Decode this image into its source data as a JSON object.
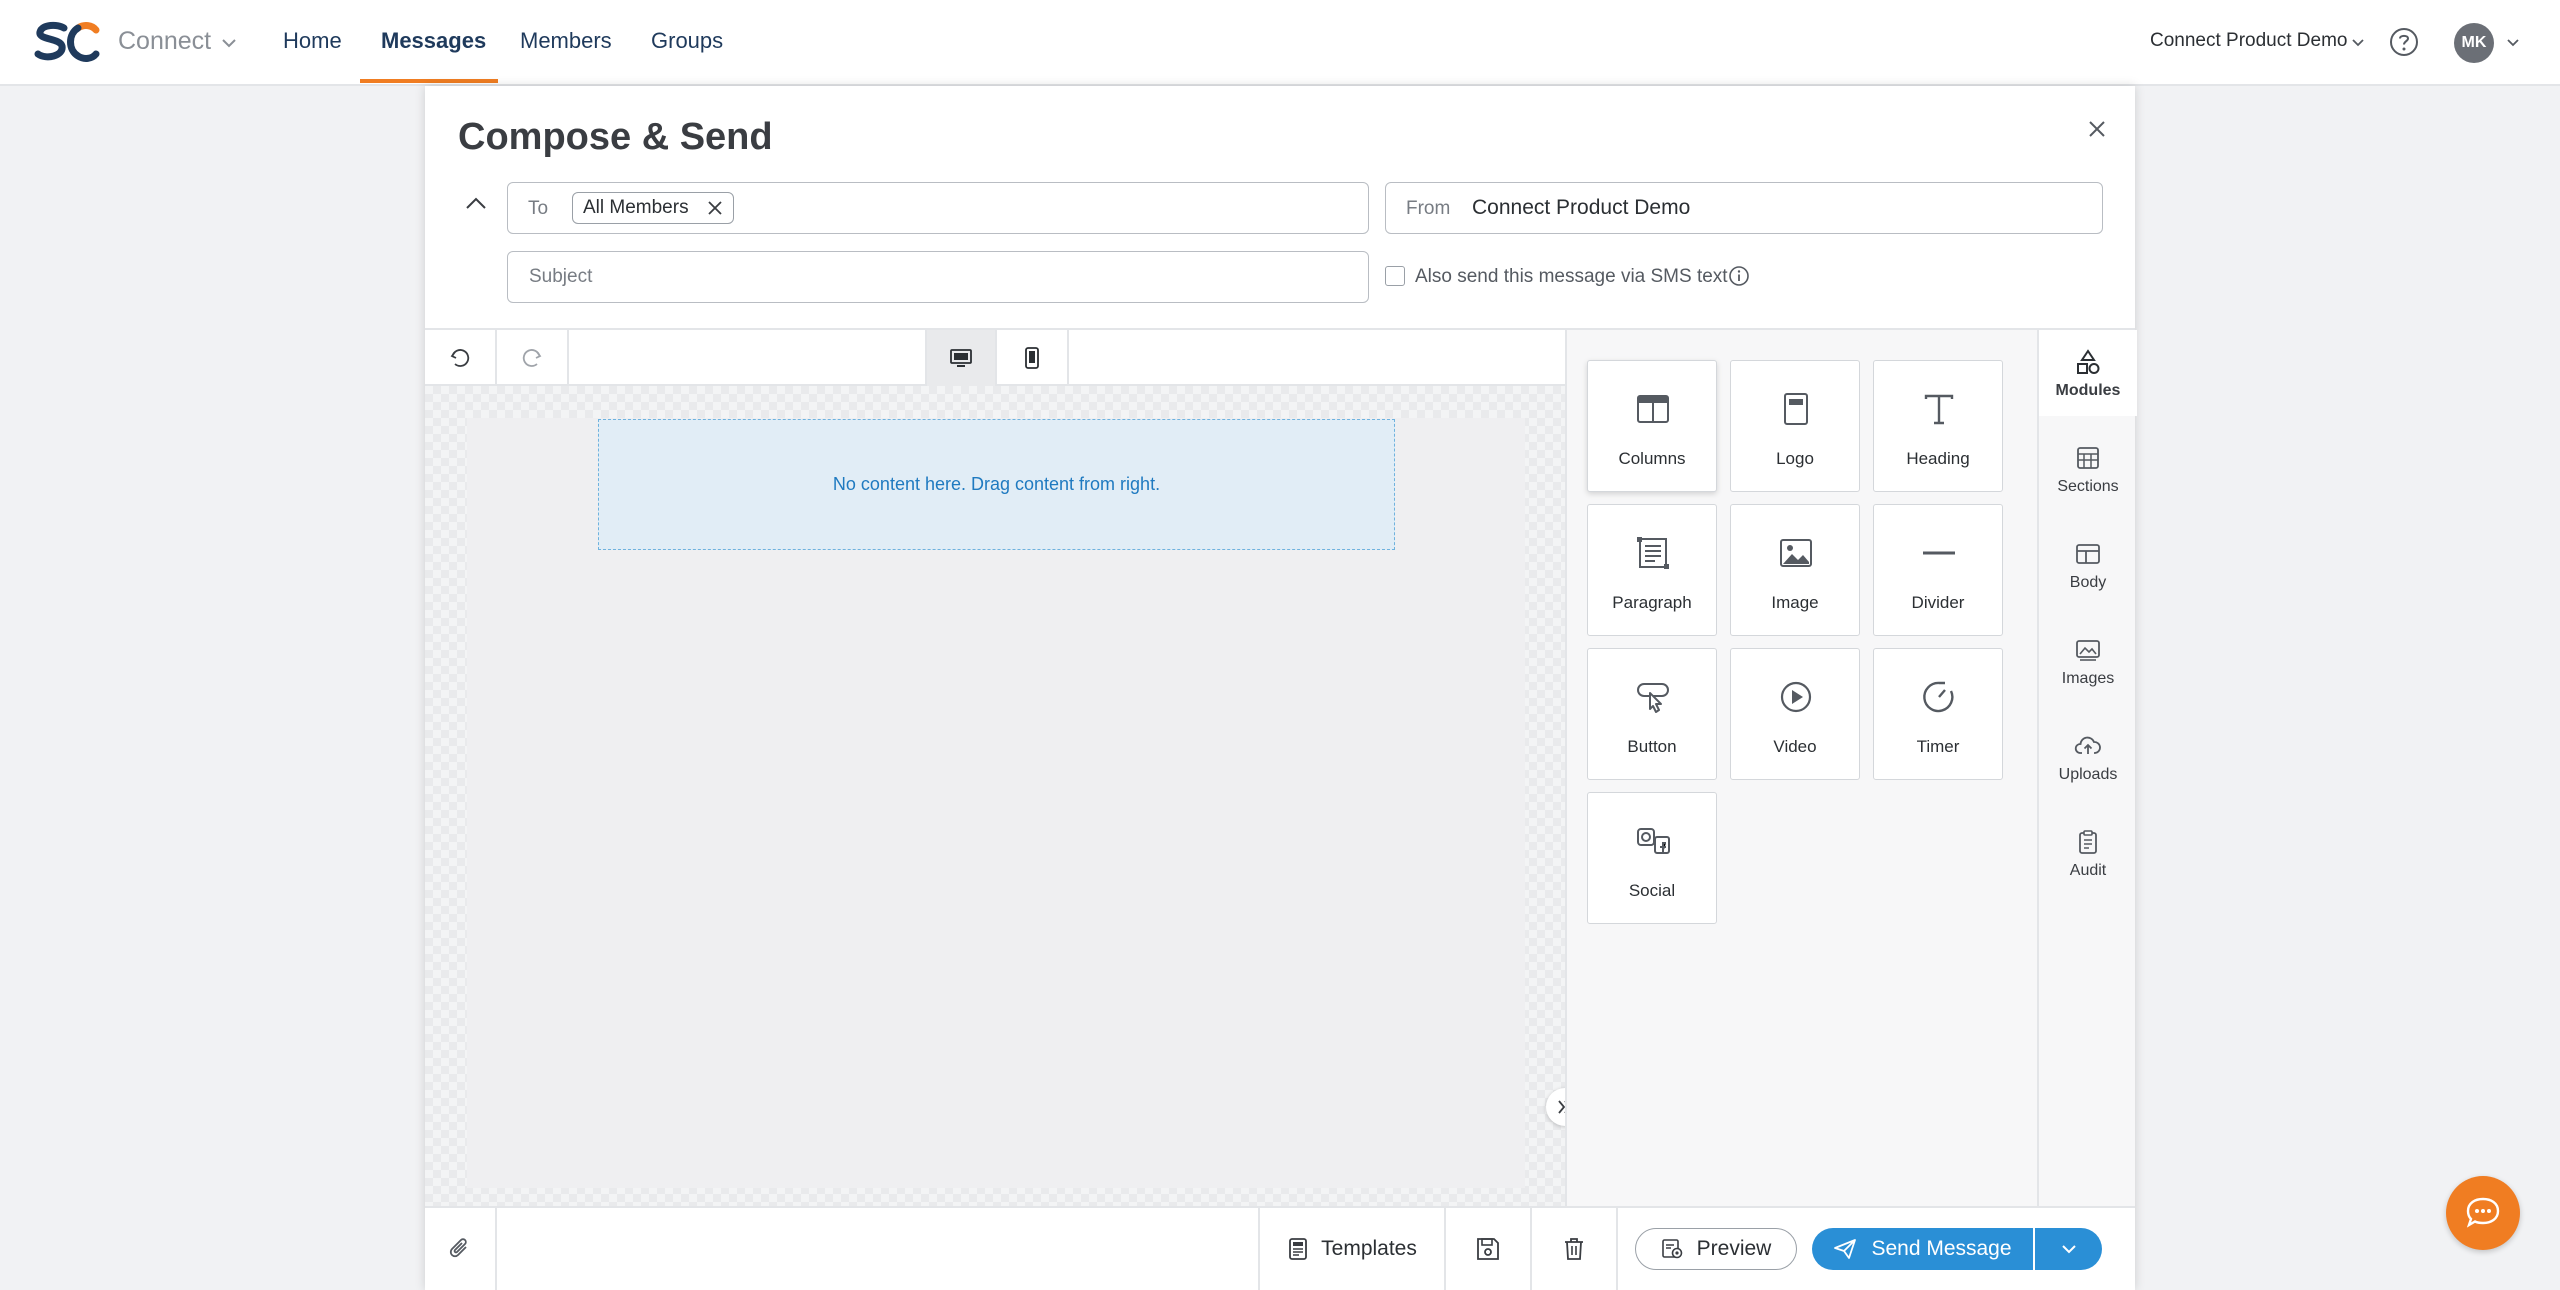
{
  "app": {
    "brand_name": "Connect",
    "nav": [
      {
        "label": "Home",
        "active": false
      },
      {
        "label": "Messages",
        "active": true
      },
      {
        "label": "Members",
        "active": false
      },
      {
        "label": "Groups",
        "active": false
      }
    ],
    "org_name": "Connect Product Demo",
    "user_initials": "MK",
    "colors": {
      "accent": "#f07d22",
      "primary": "#2a8fd6",
      "logo_navy": "#1f3a5c"
    }
  },
  "compose": {
    "title": "Compose & Send",
    "to_label": "To",
    "to_chip": "All Members",
    "from_label": "From",
    "from_value": "Connect Product Demo",
    "subject_placeholder": "Subject",
    "subject_value": "",
    "sms_label": "Also send this message via SMS text",
    "sms_checked": false
  },
  "canvas": {
    "empty_message": "No content here. Drag content from right."
  },
  "modules": [
    {
      "label": "Columns",
      "icon": "columns-icon"
    },
    {
      "label": "Logo",
      "icon": "logo-icon"
    },
    {
      "label": "Heading",
      "icon": "heading-icon"
    },
    {
      "label": "Paragraph",
      "icon": "paragraph-icon"
    },
    {
      "label": "Image",
      "icon": "image-icon"
    },
    {
      "label": "Divider",
      "icon": "divider-icon"
    },
    {
      "label": "Button",
      "icon": "button-icon"
    },
    {
      "label": "Video",
      "icon": "video-icon"
    },
    {
      "label": "Timer",
      "icon": "timer-icon"
    },
    {
      "label": "Social",
      "icon": "social-icon"
    }
  ],
  "side_tabs": [
    {
      "label": "Modules",
      "icon": "shapes-icon",
      "active": true
    },
    {
      "label": "Sections",
      "icon": "sections-icon",
      "active": false
    },
    {
      "label": "Body",
      "icon": "body-icon",
      "active": false
    },
    {
      "label": "Images",
      "icon": "images-icon",
      "active": false
    },
    {
      "label": "Uploads",
      "icon": "cloud-upload-icon",
      "active": false
    },
    {
      "label": "Audit",
      "icon": "clipboard-icon",
      "active": false
    }
  ],
  "footer": {
    "templates_label": "Templates",
    "preview_label": "Preview",
    "send_label": "Send Message"
  }
}
